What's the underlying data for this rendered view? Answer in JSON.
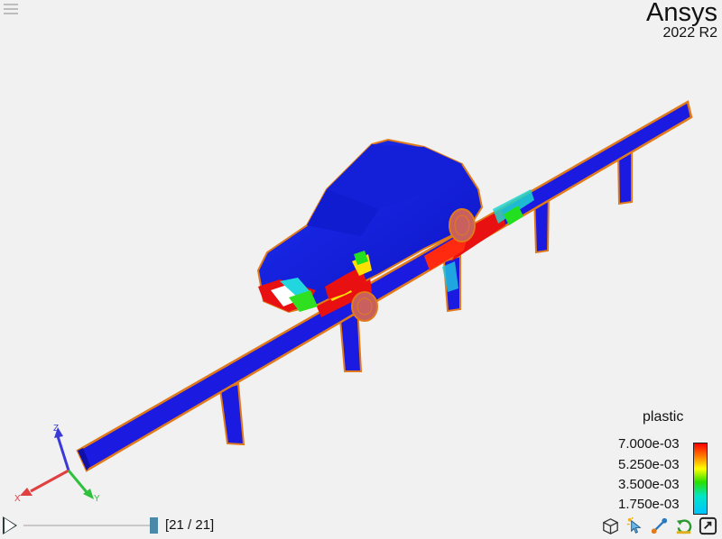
{
  "brand": {
    "name": "Ansys",
    "version": "2022 R2"
  },
  "legend": {
    "title": "plastic",
    "labels": [
      "7.000e-03",
      "5.250e-03",
      "3.500e-03",
      "1.750e-03"
    ],
    "colors": [
      "#ff0000",
      "#ff7a00",
      "#ffff00",
      "#27e000",
      "#00e6c8",
      "#00c3ff"
    ]
  },
  "axes": {
    "x": "X",
    "y": "Y",
    "z": "Z"
  },
  "animation": {
    "frame_label": "[21 / 21]",
    "current_frame": 21,
    "total_frames": 21
  },
  "toolbar": {
    "icons": [
      "cube-view-icon",
      "pick-icon",
      "measure-icon",
      "reset-view-icon",
      "fullscreen-icon"
    ]
  },
  "colors": {
    "model_blue": "#1a1ae0",
    "edge_orange": "#e07a1a",
    "background": "#f1f1f1"
  }
}
